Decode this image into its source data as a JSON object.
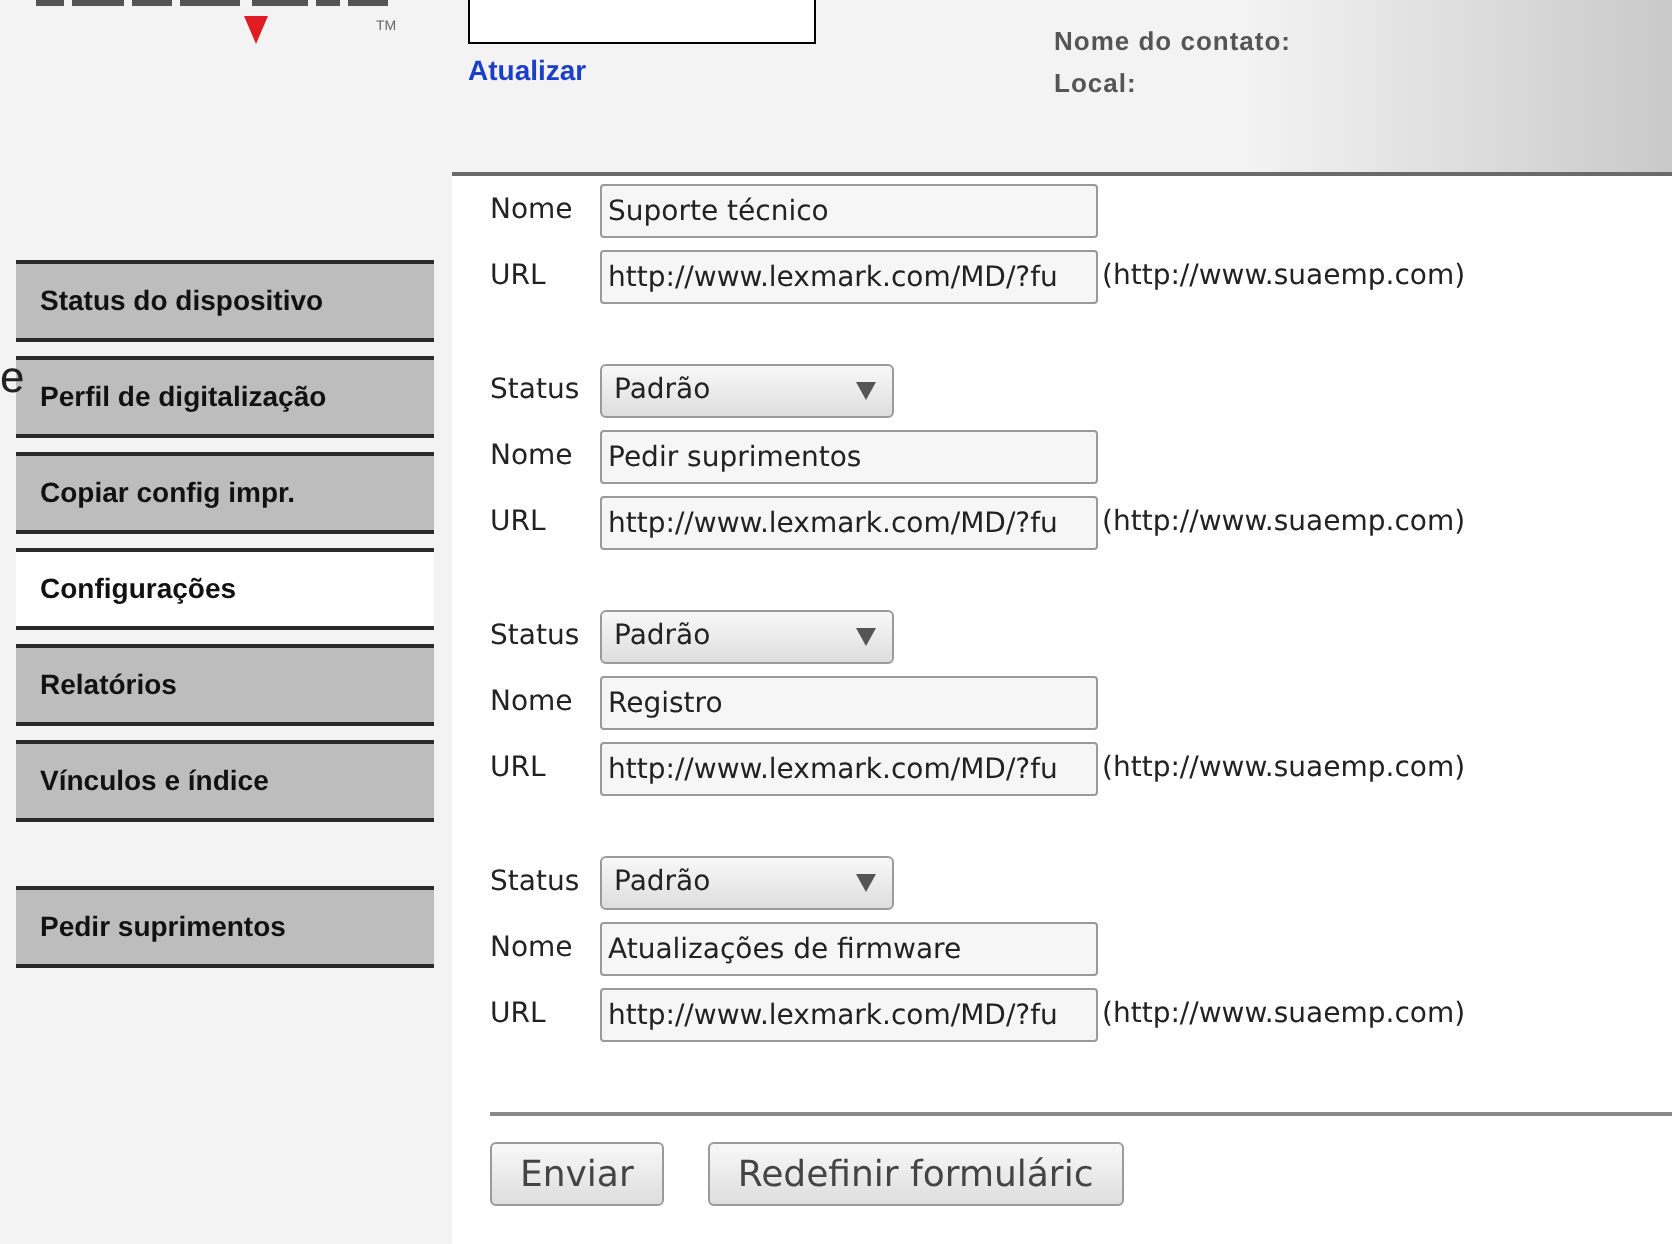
{
  "logo": {
    "mark": "TM"
  },
  "stray_text": "e",
  "header": {
    "link": "Atualizar",
    "contact_name_label": "Nome do contato:",
    "location_label": "Local:"
  },
  "sidebar": {
    "groups": [
      [
        {
          "label": "Status do dispositivo",
          "selected": false
        },
        {
          "label": "Perfil de digitalização",
          "selected": false
        },
        {
          "label": "Copiar config impr.",
          "selected": false
        },
        {
          "label": "Configurações",
          "selected": true
        },
        {
          "label": "Relatórios",
          "selected": false
        },
        {
          "label": "Vínculos e índice",
          "selected": false
        }
      ],
      [
        {
          "label": "Pedir suprimentos",
          "selected": false
        }
      ]
    ]
  },
  "links": [
    {
      "name_label": "Nome",
      "name": "Suporte técnico",
      "url_label": "URL",
      "url": "http://www.lexmark.com/MD/?fu",
      "url_hint": "(http://www.suaemp.com)"
    },
    {
      "status_label": "Status",
      "status": "Padrão",
      "name_label": "Nome",
      "name": "Pedir suprimentos",
      "url_label": "URL",
      "url": "http://www.lexmark.com/MD/?fu",
      "url_hint": "(http://www.suaemp.com)"
    },
    {
      "status_label": "Status",
      "status": "Padrão",
      "name_label": "Nome",
      "name": "Registro",
      "url_label": "URL",
      "url": "http://www.lexmark.com/MD/?fu",
      "url_hint": "(http://www.suaemp.com)"
    },
    {
      "status_label": "Status",
      "status": "Padrão",
      "name_label": "Nome",
      "name": "Atualizações de firmware",
      "url_label": "URL",
      "url": "http://www.lexmark.com/MD/?fu",
      "url_hint": "(http://www.suaemp.com)"
    }
  ],
  "buttons": [
    "Enviar",
    "Redefinir formuláric"
  ]
}
